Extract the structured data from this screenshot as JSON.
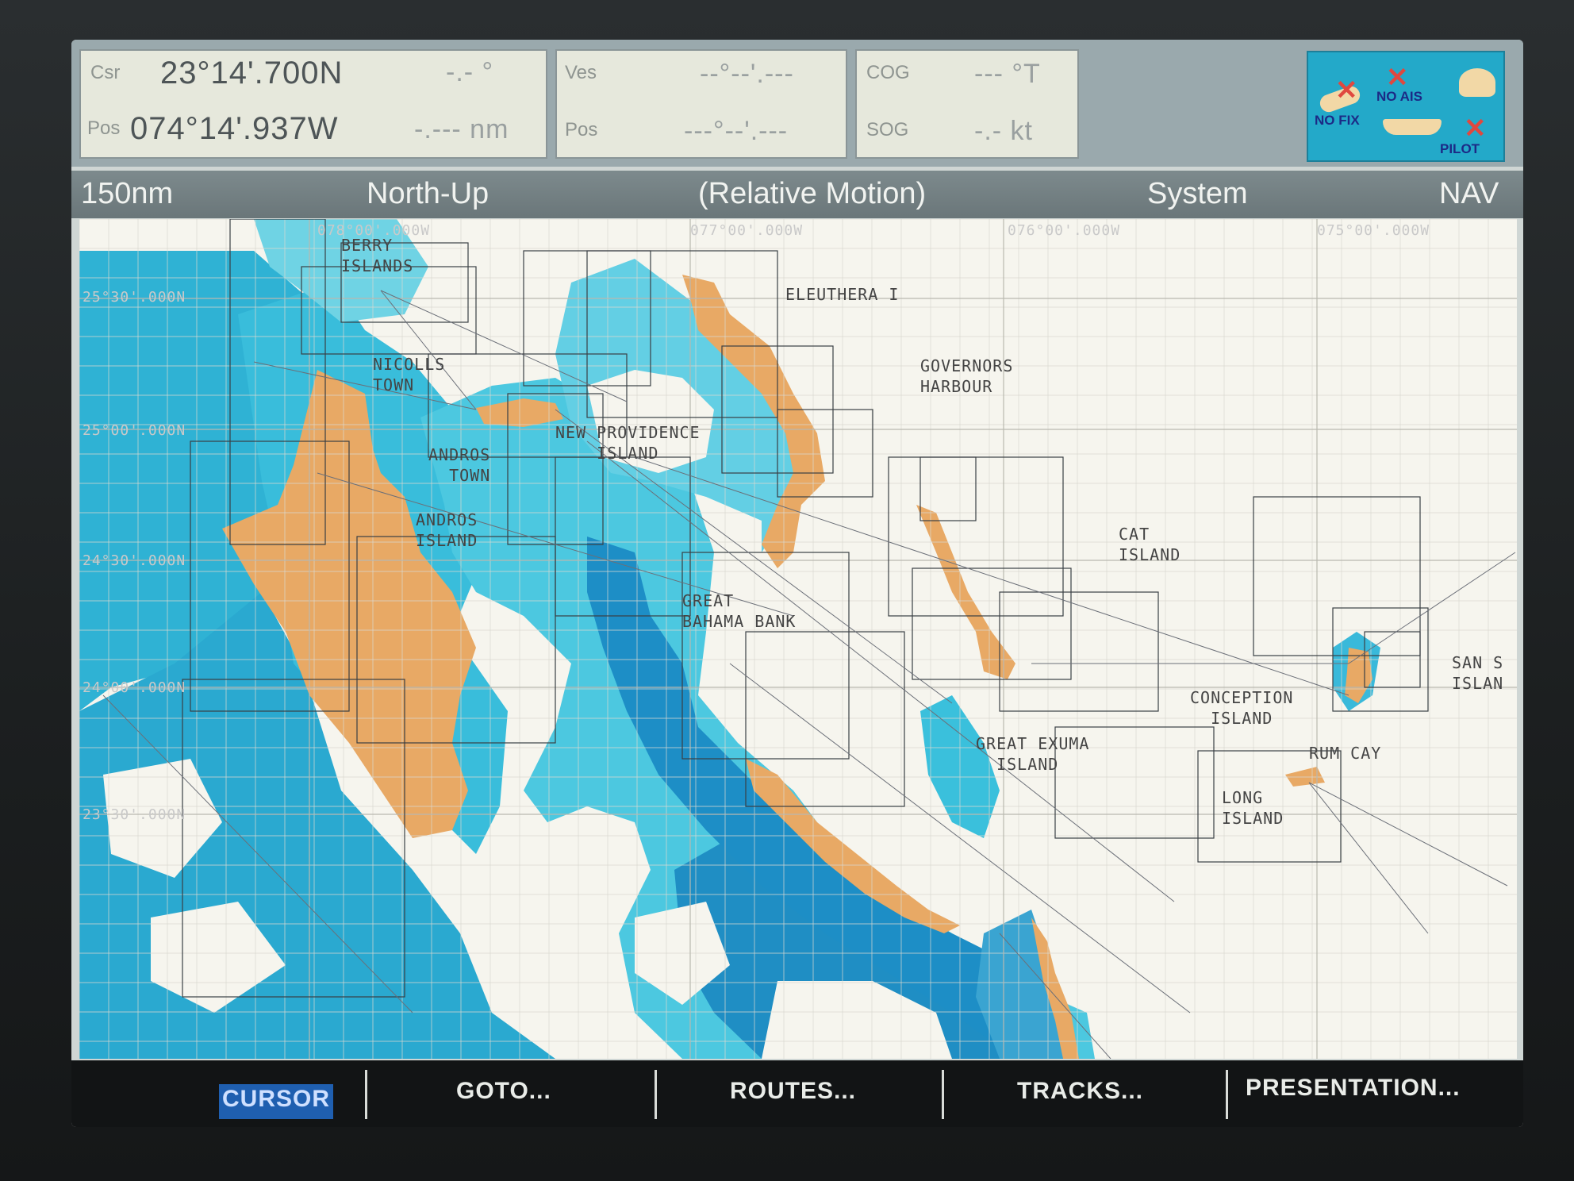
{
  "databar": {
    "cursor": {
      "label": "Csr",
      "lat": "23°14'.700N",
      "bearing": "-.- °"
    },
    "cursor_pos": {
      "label": "Pos",
      "lon": "074°14'.937W",
      "range": "-.--- nm"
    },
    "vessel": {
      "label": "Ves",
      "lat": "--°--'.---"
    },
    "vessel_pos": {
      "label": "Pos",
      "lon": "---°--'.---"
    },
    "cog": {
      "label": "COG",
      "value": "--- °T"
    },
    "sog": {
      "label": "SOG",
      "value": "-.- kt"
    },
    "status": {
      "no_fix": "NO FIX",
      "no_ais": "NO AIS",
      "pilot": "PILOT"
    }
  },
  "titlebar": {
    "range": "150nm",
    "orientation": "North-Up",
    "motion": "(Relative Motion)",
    "mode": "System",
    "page": "NAV"
  },
  "chart": {
    "grid_labels": {
      "lon_1": "078°00'.000W",
      "lon_2": "077°00'.000W",
      "lon_3": "076°00'.000W",
      "lon_4": "075°00'.000W",
      "lat_1": "25°30'.000N",
      "lat_2": "25°00'.000N",
      "lat_3": "24°30'.000N",
      "lat_4": "24°00'.000N",
      "lat_5": "23°30'.000N"
    },
    "place_names": {
      "berry": "BERRY\nISLANDS",
      "eleuthera": "ELEUTHERA I",
      "nicolls": "NICOLLS\nTOWN",
      "governors": "GOVERNORS\nHARBOUR",
      "new_providence": "NEW PROVIDENCE\n    ISLAND",
      "andros_town": "ANDROS\n  TOWN",
      "andros_island": "ANDROS\nISLAND",
      "cat": "CAT\nISLAND",
      "great_bahama": "GREAT\nBAHAMA BANK",
      "san_salvador": "SAN S\nISLAN",
      "conception": "CONCEPTION\n  ISLAND",
      "great_exuma": "GREAT EXUMA\n  ISLAND",
      "rum_cay": "RUM CAY",
      "long": "LONG\nISLAND"
    },
    "colors": {
      "land": "#e8a965",
      "shallow": "#5fcde2",
      "medium": "#33aed0",
      "deep_bank": "#2a93c5",
      "chart_bg": "#f6f5ee"
    }
  },
  "softkeys": {
    "cursor": "CURSOR",
    "goto": "GOTO...",
    "routes": "ROUTES...",
    "tracks": "TRACKS...",
    "presentation": "PRESENTATION..."
  }
}
